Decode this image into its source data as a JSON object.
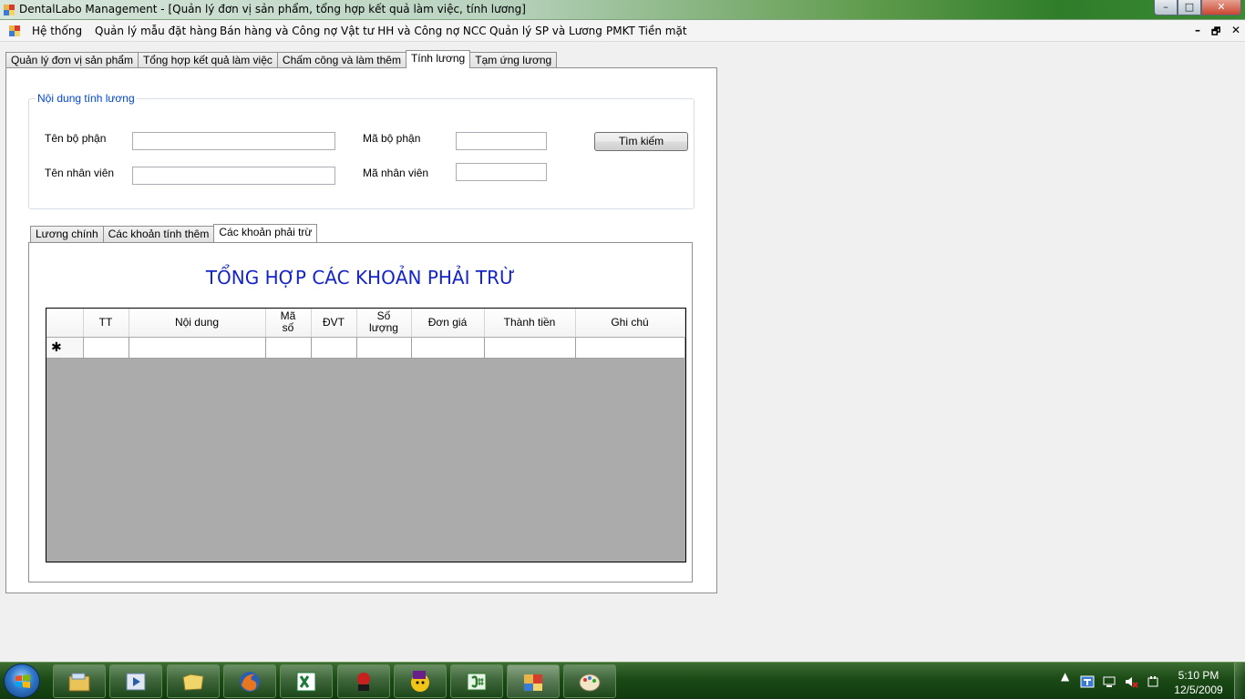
{
  "window": {
    "title": "DentalLabo Management - [Quản lý đơn vị sản phẩm, tổng hợp kết quả làm việc, tính lương]",
    "controls": {
      "minimize": "–",
      "maximize": "□",
      "close": "✕"
    }
  },
  "menu": {
    "items": [
      "Hệ thống",
      "Quản lý mẫu đặt hàng",
      "Bán hàng và Công nợ",
      "Vật tư HH và Công nợ NCC",
      "Quản lý SP và Lương",
      "PMKT Tiền mặt"
    ],
    "mdi_controls": {
      "minimize": "–",
      "restore": "🗗",
      "close": "✕"
    }
  },
  "outer_tabs": [
    "Quản lý đơn vị sản phẩm",
    "Tổng hợp kết quả làm việc",
    "Chấm công và làm thêm",
    "Tính lương",
    "Tạm ứng lương"
  ],
  "outer_active_tab": "Tính lương",
  "search_group": {
    "legend": "Nội dung tính lương",
    "dept_name_label": "Tên bộ phận",
    "dept_name_value": "",
    "dept_code_label": "Mã bộ phận",
    "dept_code_value": "",
    "emp_name_label": "Tên nhân viên",
    "emp_name_value": "",
    "emp_code_label": "Mã nhân viên",
    "emp_code_value": "",
    "search_button": "Tìm kiếm"
  },
  "inner_tabs": [
    "Lương chính",
    "Các khoản tính thêm",
    "Các khoản phải trừ"
  ],
  "inner_active_tab": "Các khoản phải trừ",
  "deductions": {
    "heading": "TỔNG HỢP CÁC KHOẢN PHẢI TRỪ",
    "columns": [
      "TT",
      "Nội dung",
      "Mã số",
      "ĐVT",
      "Số lượng",
      "Đơn giá",
      "Thành tiền",
      "Ghi chú"
    ],
    "new_row_marker": "✱",
    "rows": []
  },
  "taskbar": {
    "apps": [
      "file-explorer-icon",
      "media-player-icon",
      "folder-icon",
      "firefox-icon",
      "excel-icon",
      "game-icon",
      "yahoo-messenger-icon",
      "csharp-ide-icon",
      "dentallabo-app-icon",
      "paint-icon"
    ],
    "clock_time": "5:10 PM",
    "clock_date": "12/5/2009"
  }
}
